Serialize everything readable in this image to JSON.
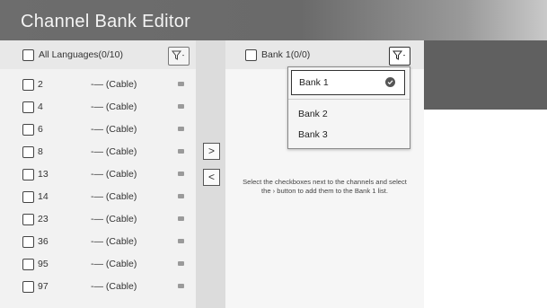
{
  "window": {
    "title": "Channel Bank Editor"
  },
  "left_panel": {
    "header_label": "All Languages(0/10)",
    "channels": [
      {
        "number": "2",
        "source": "-— (Cable)"
      },
      {
        "number": "4",
        "source": "-— (Cable)"
      },
      {
        "number": "6",
        "source": "-— (Cable)"
      },
      {
        "number": "8",
        "source": "-— (Cable)"
      },
      {
        "number": "13",
        "source": "-— (Cable)"
      },
      {
        "number": "14",
        "source": "-— (Cable)"
      },
      {
        "number": "23",
        "source": "-— (Cable)"
      },
      {
        "number": "36",
        "source": "-— (Cable)"
      },
      {
        "number": "95",
        "source": "-— (Cable)"
      },
      {
        "number": "97",
        "source": "-— (Cable)"
      }
    ]
  },
  "middle": {
    "add_button": ">",
    "remove_button": "<"
  },
  "right_panel": {
    "header_label": "Bank 1(0/0)",
    "help_text": "Select the checkboxes next to the channels and select the › button to add them to the Bank 1 list."
  },
  "dropdown": {
    "items": [
      "Bank 1",
      "Bank 2",
      "Bank 3"
    ],
    "selected_index": 0
  },
  "icons": {
    "filter": "filter-icon",
    "tv": "tv-icon",
    "check": "checkmark-icon"
  }
}
